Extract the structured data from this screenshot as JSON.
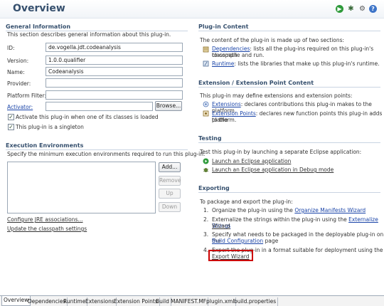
{
  "header": {
    "title": "Overview",
    "icons": [
      "run-icon",
      "bug-icon",
      "gear-icon",
      "help-icon"
    ]
  },
  "general": {
    "title": "General Information",
    "desc": "This section describes general information about this plug-in.",
    "fields": [
      {
        "label": "ID:",
        "value": "de.vogella.jdt.codeanalysis"
      },
      {
        "label": "Version:",
        "value": "1.0.0.qualifier"
      },
      {
        "label": "Name:",
        "value": "Codeanalysis"
      },
      {
        "label": "Provider:",
        "value": ""
      },
      {
        "label": "Platform Filter:",
        "value": ""
      }
    ],
    "activator_label": "Activator:",
    "activator_value": "",
    "browse_label": "Browse...",
    "checkbox1": "Activate this plug-in when one of its classes is loaded",
    "checkbox2": "This plug-in is a singleton"
  },
  "exec_env": {
    "title": "Execution Environments",
    "desc": "Specify the minimum execution environments required to run this plug-in.",
    "buttons": [
      "Add...",
      "Remove",
      "Up",
      "Down"
    ],
    "link1": "Configure JRE associations...",
    "link2": "Update the classpath settings"
  },
  "content": {
    "title": "Plug-in Content",
    "desc": "The content of the plug-in is made up of two sections:",
    "dep_link": "Dependencies",
    "dep_text_1": ": lists all the plug-ins required on this plug-in's classpath",
    "dep_text_2": "to compile and run.",
    "rt_link": "Runtime",
    "rt_text": ": lists the libraries that make up this plug-in's runtime."
  },
  "extension": {
    "title": "Extension / Extension Point Content",
    "desc": "This plug-in may define extensions and extension points:",
    "ext_link": "Extensions",
    "ext_text": ": declares contributions this plug-in makes to the platform.",
    "ep_link": "Extension Points",
    "ep_text_1": ": declares new function points this plug-in adds to the",
    "ep_text_2": "platform."
  },
  "testing": {
    "title": "Testing",
    "desc": "Test this plug-in by launching a separate Eclipse application:",
    "launch": "Launch an Eclipse application",
    "debug": "Launch an Eclipse application in Debug mode"
  },
  "exporting": {
    "title": "Exporting",
    "desc": "To package and export the plug-in:",
    "s1_num": "1.",
    "s1_text": "Organize the plug-in using the ",
    "s1_link": "Organize Manifests Wizard",
    "s2_num": "2.",
    "s2_text": "Externalize the strings within the plug-in using the ",
    "s2_link_a": "Externalize Strings",
    "s2_link_b": "Wizard",
    "s3_num": "3.",
    "s3_text_a": "Specify what needs to be packaged in the deployable plug-in on the",
    "s3_link": "Build Configuration",
    "s3_text_b": " page",
    "s4_num": "4.",
    "s4_text": "Export the plug-in in a format suitable for deployment using the",
    "s4_link": "Export Wizard"
  },
  "tabs": [
    "Overview",
    "Dependencies",
    "Runtime",
    "Extensions",
    "Extension Points",
    "Build",
    "MANIFEST.MF",
    "plugin.xml",
    "build.properties"
  ],
  "colors": {
    "section_title": "#36506e",
    "link": "#1a44a8",
    "highlight": "#cc0000"
  }
}
